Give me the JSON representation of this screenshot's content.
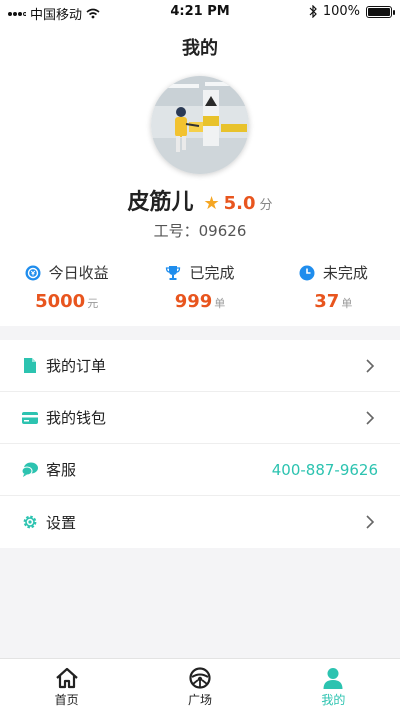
{
  "status_bar": {
    "carrier": "中国移动",
    "time": "4:21 PM",
    "battery": "100%"
  },
  "header": {
    "title": "我的"
  },
  "profile": {
    "name": "皮筋儿",
    "rating": "5.0",
    "rating_unit": "分",
    "worker_id": "工号：09626"
  },
  "stats": [
    {
      "label": "今日收益",
      "value": "5000",
      "unit": "元",
      "icon": "coin-icon"
    },
    {
      "label": "已完成",
      "value": "999",
      "unit": "单",
      "icon": "trophy-icon"
    },
    {
      "label": "未完成",
      "value": "37",
      "unit": "单",
      "icon": "clock-icon"
    }
  ],
  "menu": [
    {
      "label": "我的订单",
      "icon": "document-icon"
    },
    {
      "label": "我的钱包",
      "icon": "card-icon"
    },
    {
      "label": "客服",
      "icon": "chat-icon",
      "value": "400-887-9626"
    },
    {
      "label": "设置",
      "icon": "gear-icon"
    }
  ],
  "tabbar": [
    {
      "label": "首页",
      "icon": "home-icon"
    },
    {
      "label": "广场",
      "icon": "wheel-icon"
    },
    {
      "label": "我的",
      "icon": "person-icon",
      "active": true
    }
  ],
  "colors": {
    "accent": "#2cc3b0",
    "highlight": "#e8551e",
    "star": "#f5a623",
    "icon_blue": "#1f8ded"
  }
}
